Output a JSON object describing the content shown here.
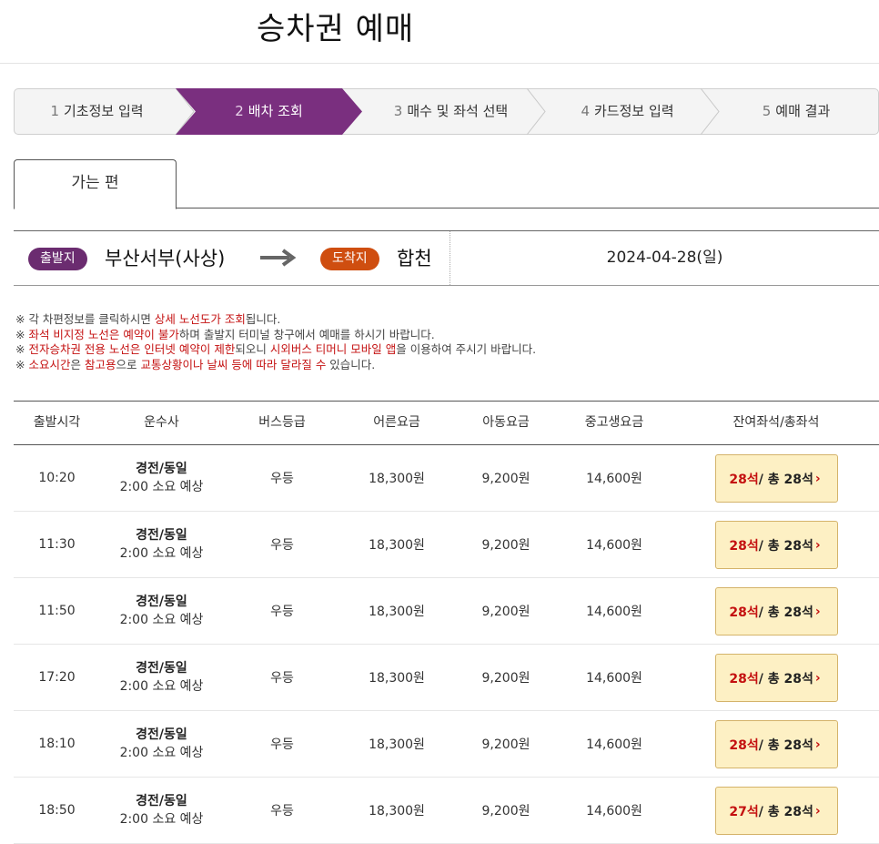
{
  "page": {
    "title": "승차권 예매"
  },
  "steps": [
    {
      "num": "1",
      "label": "기초정보 입력",
      "active": false
    },
    {
      "num": "2",
      "label": "배차 조회",
      "active": true
    },
    {
      "num": "3",
      "label": "매수 및 좌석 선택",
      "active": false
    },
    {
      "num": "4",
      "label": "카드정보 입력",
      "active": false
    },
    {
      "num": "5",
      "label": "예매 결과",
      "active": false
    }
  ],
  "tab": {
    "label": "가는 편"
  },
  "route": {
    "departure_badge": "출발지",
    "departure": "부산서부(사상)",
    "arrival_badge": "도착지",
    "arrival": "합천",
    "date": "2024-04-28(일)",
    "arrow_icon": "right-arrow-icon"
  },
  "notes": [
    {
      "parts": [
        {
          "t": "※ 각 차편정보를 클릭하시면 ",
          "hl": false
        },
        {
          "t": "상세 노선도가 조회",
          "hl": true
        },
        {
          "t": "됩니다.",
          "hl": false
        }
      ]
    },
    {
      "parts": [
        {
          "t": "※ ",
          "hl": false
        },
        {
          "t": "좌석 비지정 노선은 예약이 불가",
          "hl": true
        },
        {
          "t": "하며 출발지 터미널 창구에서 예매를 하시기 바랍니다.",
          "hl": false
        }
      ]
    },
    {
      "parts": [
        {
          "t": "※ ",
          "hl": false
        },
        {
          "t": "전자승차권 전용 노선은 인터넷 예약이 제한",
          "hl": true
        },
        {
          "t": "되오니 ",
          "hl": false
        },
        {
          "t": "시외버스 티머니 모바일 앱",
          "hl": true
        },
        {
          "t": "을 이용하여 주시기 바랍니다.",
          "hl": false
        }
      ]
    },
    {
      "parts": [
        {
          "t": "※ ",
          "hl": false
        },
        {
          "t": "소요시간",
          "hl": true
        },
        {
          "t": "은 ",
          "hl": false
        },
        {
          "t": "참고용",
          "hl": true
        },
        {
          "t": "으로 ",
          "hl": false
        },
        {
          "t": "교통상황이나 날씨 등에 따라 달라질 수",
          "hl": true
        },
        {
          "t": " 있습니다.",
          "hl": false
        }
      ]
    }
  ],
  "table": {
    "headers": [
      "출발시각",
      "운수사",
      "버스등급",
      "어른요금",
      "아동요금",
      "중고생요금",
      "잔여좌석/총좌석"
    ],
    "rows": [
      {
        "time": "10:20",
        "company": "경전/동일",
        "duration": "2:00 소요 예상",
        "grade": "우등",
        "adult": "18,300원",
        "child": "9,200원",
        "youth": "14,600원",
        "remaining": "28석",
        "total": " / 총 28석"
      },
      {
        "time": "11:30",
        "company": "경전/동일",
        "duration": "2:00 소요 예상",
        "grade": "우등",
        "adult": "18,300원",
        "child": "9,200원",
        "youth": "14,600원",
        "remaining": "28석",
        "total": " / 총 28석"
      },
      {
        "time": "11:50",
        "company": "경전/동일",
        "duration": "2:00 소요 예상",
        "grade": "우등",
        "adult": "18,300원",
        "child": "9,200원",
        "youth": "14,600원",
        "remaining": "28석",
        "total": " / 총 28석"
      },
      {
        "time": "17:20",
        "company": "경전/동일",
        "duration": "2:00 소요 예상",
        "grade": "우등",
        "adult": "18,300원",
        "child": "9,200원",
        "youth": "14,600원",
        "remaining": "28석",
        "total": " / 총 28석"
      },
      {
        "time": "18:10",
        "company": "경전/동일",
        "duration": "2:00 소요 예상",
        "grade": "우등",
        "adult": "18,300원",
        "child": "9,200원",
        "youth": "14,600원",
        "remaining": "28석",
        "total": " / 총 28석"
      },
      {
        "time": "18:50",
        "company": "경전/동일",
        "duration": "2:00 소요 예상",
        "grade": "우등",
        "adult": "18,300원",
        "child": "9,200원",
        "youth": "14,600원",
        "remaining": "27석",
        "total": " / 총 28석"
      }
    ]
  },
  "colors": {
    "accent_purple": "#7a2f7f",
    "arrival_orange": "#cf4e10",
    "highlight_red": "#c41010",
    "seat_button_bg": "#fdf0c4"
  }
}
